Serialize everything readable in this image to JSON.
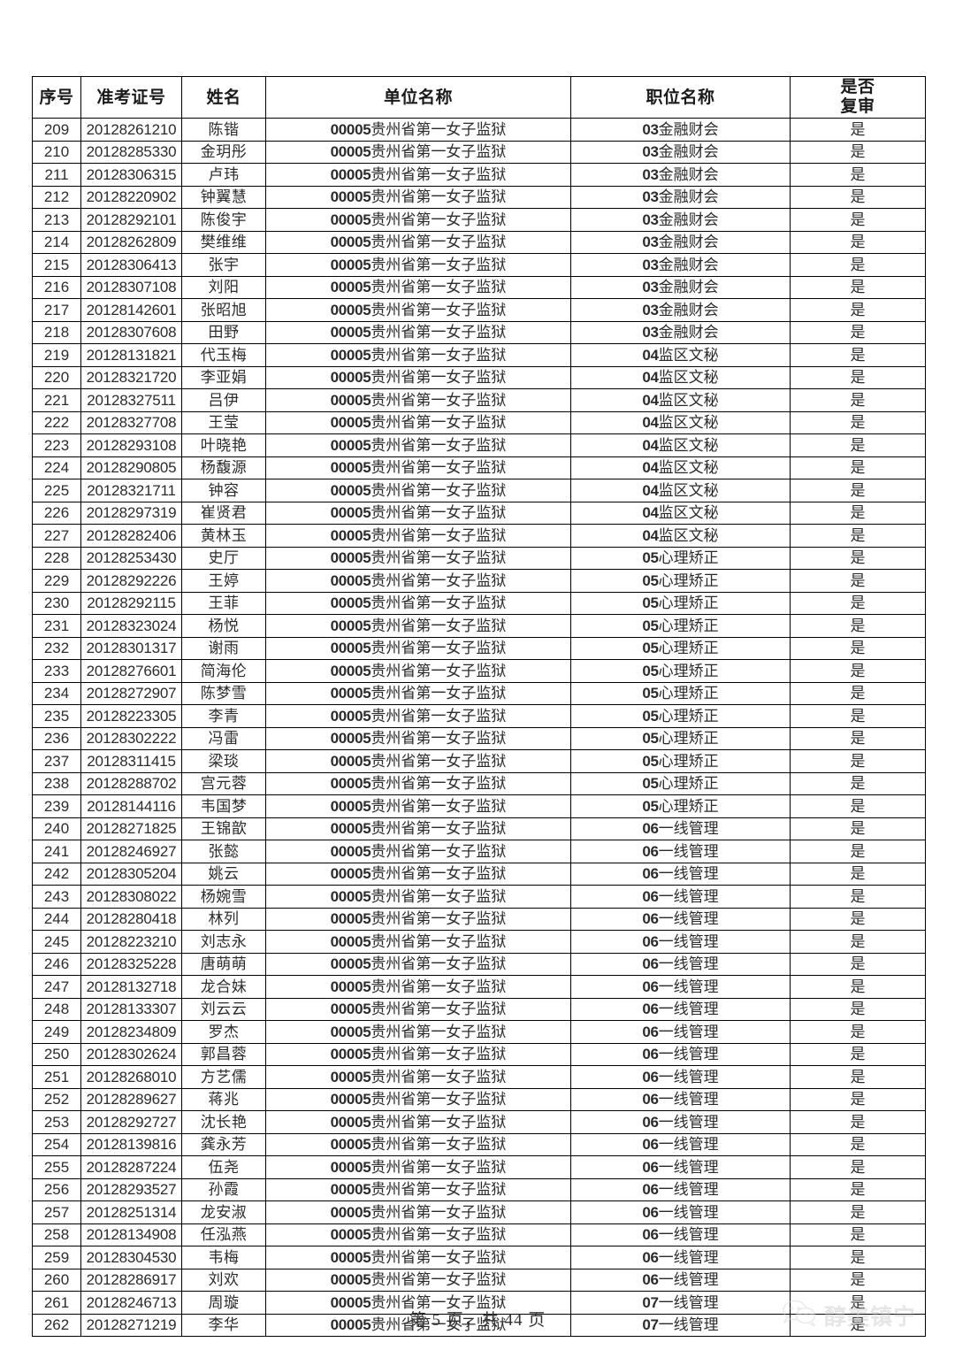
{
  "document": {
    "footer_text": "第 5 页，共 44 页",
    "watermark_text": "醇美镇宁",
    "watermark_icon": "wechat-icon"
  },
  "table": {
    "headers": {
      "seq": "序号",
      "admission_no": "准考证号",
      "name": "姓名",
      "unit_name": "单位名称",
      "post_name": "职位名称",
      "review_line1": "是否",
      "review_line2": "复审"
    },
    "rows": [
      {
        "seq": "209",
        "adm": "20128261210",
        "name": "陈锴",
        "unit_code": "00005",
        "unit": "贵州省第一女子监狱",
        "post_code": "03",
        "post": "金融财会",
        "rev": "是"
      },
      {
        "seq": "210",
        "adm": "20128285330",
        "name": "金玥彤",
        "unit_code": "00005",
        "unit": "贵州省第一女子监狱",
        "post_code": "03",
        "post": "金融财会",
        "rev": "是"
      },
      {
        "seq": "211",
        "adm": "20128306315",
        "name": "卢玮",
        "unit_code": "00005",
        "unit": "贵州省第一女子监狱",
        "post_code": "03",
        "post": "金融财会",
        "rev": "是"
      },
      {
        "seq": "212",
        "adm": "20128220902",
        "name": "钟翼慧",
        "unit_code": "00005",
        "unit": "贵州省第一女子监狱",
        "post_code": "03",
        "post": "金融财会",
        "rev": "是"
      },
      {
        "seq": "213",
        "adm": "20128292101",
        "name": "陈俊宇",
        "unit_code": "00005",
        "unit": "贵州省第一女子监狱",
        "post_code": "03",
        "post": "金融财会",
        "rev": "是"
      },
      {
        "seq": "214",
        "adm": "20128262809",
        "name": "樊维维",
        "unit_code": "00005",
        "unit": "贵州省第一女子监狱",
        "post_code": "03",
        "post": "金融财会",
        "rev": "是"
      },
      {
        "seq": "215",
        "adm": "20128306413",
        "name": "张宇",
        "unit_code": "00005",
        "unit": "贵州省第一女子监狱",
        "post_code": "03",
        "post": "金融财会",
        "rev": "是"
      },
      {
        "seq": "216",
        "adm": "20128307108",
        "name": "刘阳",
        "unit_code": "00005",
        "unit": "贵州省第一女子监狱",
        "post_code": "03",
        "post": "金融财会",
        "rev": "是"
      },
      {
        "seq": "217",
        "adm": "20128142601",
        "name": "张昭旭",
        "unit_code": "00005",
        "unit": "贵州省第一女子监狱",
        "post_code": "03",
        "post": "金融财会",
        "rev": "是"
      },
      {
        "seq": "218",
        "adm": "20128307608",
        "name": "田野",
        "unit_code": "00005",
        "unit": "贵州省第一女子监狱",
        "post_code": "03",
        "post": "金融财会",
        "rev": "是"
      },
      {
        "seq": "219",
        "adm": "20128131821",
        "name": "代玉梅",
        "unit_code": "00005",
        "unit": "贵州省第一女子监狱",
        "post_code": "04",
        "post": "监区文秘",
        "rev": "是"
      },
      {
        "seq": "220",
        "adm": "20128321720",
        "name": "李亚娟",
        "unit_code": "00005",
        "unit": "贵州省第一女子监狱",
        "post_code": "04",
        "post": "监区文秘",
        "rev": "是"
      },
      {
        "seq": "221",
        "adm": "20128327511",
        "name": "吕伊",
        "unit_code": "00005",
        "unit": "贵州省第一女子监狱",
        "post_code": "04",
        "post": "监区文秘",
        "rev": "是"
      },
      {
        "seq": "222",
        "adm": "20128327708",
        "name": "王莹",
        "unit_code": "00005",
        "unit": "贵州省第一女子监狱",
        "post_code": "04",
        "post": "监区文秘",
        "rev": "是"
      },
      {
        "seq": "223",
        "adm": "20128293108",
        "name": "叶晓艳",
        "unit_code": "00005",
        "unit": "贵州省第一女子监狱",
        "post_code": "04",
        "post": "监区文秘",
        "rev": "是"
      },
      {
        "seq": "224",
        "adm": "20128290805",
        "name": "杨馥源",
        "unit_code": "00005",
        "unit": "贵州省第一女子监狱",
        "post_code": "04",
        "post": "监区文秘",
        "rev": "是"
      },
      {
        "seq": "225",
        "adm": "20128321711",
        "name": "钟容",
        "unit_code": "00005",
        "unit": "贵州省第一女子监狱",
        "post_code": "04",
        "post": "监区文秘",
        "rev": "是"
      },
      {
        "seq": "226",
        "adm": "20128297319",
        "name": "崔贤君",
        "unit_code": "00005",
        "unit": "贵州省第一女子监狱",
        "post_code": "04",
        "post": "监区文秘",
        "rev": "是"
      },
      {
        "seq": "227",
        "adm": "20128282406",
        "name": "黄林玉",
        "unit_code": "00005",
        "unit": "贵州省第一女子监狱",
        "post_code": "04",
        "post": "监区文秘",
        "rev": "是"
      },
      {
        "seq": "228",
        "adm": "20128253430",
        "name": "史厅",
        "unit_code": "00005",
        "unit": "贵州省第一女子监狱",
        "post_code": "05",
        "post": "心理矫正",
        "rev": "是"
      },
      {
        "seq": "229",
        "adm": "20128292226",
        "name": "王婷",
        "unit_code": "00005",
        "unit": "贵州省第一女子监狱",
        "post_code": "05",
        "post": "心理矫正",
        "rev": "是"
      },
      {
        "seq": "230",
        "adm": "20128292115",
        "name": "王菲",
        "unit_code": "00005",
        "unit": "贵州省第一女子监狱",
        "post_code": "05",
        "post": "心理矫正",
        "rev": "是"
      },
      {
        "seq": "231",
        "adm": "20128323024",
        "name": "杨悦",
        "unit_code": "00005",
        "unit": "贵州省第一女子监狱",
        "post_code": "05",
        "post": "心理矫正",
        "rev": "是"
      },
      {
        "seq": "232",
        "adm": "20128301317",
        "name": "谢雨",
        "unit_code": "00005",
        "unit": "贵州省第一女子监狱",
        "post_code": "05",
        "post": "心理矫正",
        "rev": "是"
      },
      {
        "seq": "233",
        "adm": "20128276601",
        "name": "简海伦",
        "unit_code": "00005",
        "unit": "贵州省第一女子监狱",
        "post_code": "05",
        "post": "心理矫正",
        "rev": "是"
      },
      {
        "seq": "234",
        "adm": "20128272907",
        "name": "陈梦雪",
        "unit_code": "00005",
        "unit": "贵州省第一女子监狱",
        "post_code": "05",
        "post": "心理矫正",
        "rev": "是"
      },
      {
        "seq": "235",
        "adm": "20128223305",
        "name": "李青",
        "unit_code": "00005",
        "unit": "贵州省第一女子监狱",
        "post_code": "05",
        "post": "心理矫正",
        "rev": "是"
      },
      {
        "seq": "236",
        "adm": "20128302222",
        "name": "冯雷",
        "unit_code": "00005",
        "unit": "贵州省第一女子监狱",
        "post_code": "05",
        "post": "心理矫正",
        "rev": "是"
      },
      {
        "seq": "237",
        "adm": "20128311415",
        "name": "梁琰",
        "unit_code": "00005",
        "unit": "贵州省第一女子监狱",
        "post_code": "05",
        "post": "心理矫正",
        "rev": "是"
      },
      {
        "seq": "238",
        "adm": "20128288702",
        "name": "宫元蓉",
        "unit_code": "00005",
        "unit": "贵州省第一女子监狱",
        "post_code": "05",
        "post": "心理矫正",
        "rev": "是"
      },
      {
        "seq": "239",
        "adm": "20128144116",
        "name": "韦国梦",
        "unit_code": "00005",
        "unit": "贵州省第一女子监狱",
        "post_code": "05",
        "post": "心理矫正",
        "rev": "是"
      },
      {
        "seq": "240",
        "adm": "20128271825",
        "name": "王锦歆",
        "unit_code": "00005",
        "unit": "贵州省第一女子监狱",
        "post_code": "06",
        "post": "一线管理",
        "rev": "是"
      },
      {
        "seq": "241",
        "adm": "20128246927",
        "name": "张懿",
        "unit_code": "00005",
        "unit": "贵州省第一女子监狱",
        "post_code": "06",
        "post": "一线管理",
        "rev": "是"
      },
      {
        "seq": "242",
        "adm": "20128305204",
        "name": "姚云",
        "unit_code": "00005",
        "unit": "贵州省第一女子监狱",
        "post_code": "06",
        "post": "一线管理",
        "rev": "是"
      },
      {
        "seq": "243",
        "adm": "20128308022",
        "name": "杨婉雪",
        "unit_code": "00005",
        "unit": "贵州省第一女子监狱",
        "post_code": "06",
        "post": "一线管理",
        "rev": "是"
      },
      {
        "seq": "244",
        "adm": "20128280418",
        "name": "林列",
        "unit_code": "00005",
        "unit": "贵州省第一女子监狱",
        "post_code": "06",
        "post": "一线管理",
        "rev": "是"
      },
      {
        "seq": "245",
        "adm": "20128223210",
        "name": "刘志永",
        "unit_code": "00005",
        "unit": "贵州省第一女子监狱",
        "post_code": "06",
        "post": "一线管理",
        "rev": "是"
      },
      {
        "seq": "246",
        "adm": "20128325228",
        "name": "唐萌萌",
        "unit_code": "00005",
        "unit": "贵州省第一女子监狱",
        "post_code": "06",
        "post": "一线管理",
        "rev": "是"
      },
      {
        "seq": "247",
        "adm": "20128132718",
        "name": "龙合妹",
        "unit_code": "00005",
        "unit": "贵州省第一女子监狱",
        "post_code": "06",
        "post": "一线管理",
        "rev": "是"
      },
      {
        "seq": "248",
        "adm": "20128133307",
        "name": "刘云云",
        "unit_code": "00005",
        "unit": "贵州省第一女子监狱",
        "post_code": "06",
        "post": "一线管理",
        "rev": "是"
      },
      {
        "seq": "249",
        "adm": "20128234809",
        "name": "罗杰",
        "unit_code": "00005",
        "unit": "贵州省第一女子监狱",
        "post_code": "06",
        "post": "一线管理",
        "rev": "是"
      },
      {
        "seq": "250",
        "adm": "20128302624",
        "name": "郭昌蓉",
        "unit_code": "00005",
        "unit": "贵州省第一女子监狱",
        "post_code": "06",
        "post": "一线管理",
        "rev": "是"
      },
      {
        "seq": "251",
        "adm": "20128268010",
        "name": "方艺儒",
        "unit_code": "00005",
        "unit": "贵州省第一女子监狱",
        "post_code": "06",
        "post": "一线管理",
        "rev": "是"
      },
      {
        "seq": "252",
        "adm": "20128289627",
        "name": "蒋兆",
        "unit_code": "00005",
        "unit": "贵州省第一女子监狱",
        "post_code": "06",
        "post": "一线管理",
        "rev": "是"
      },
      {
        "seq": "253",
        "adm": "20128292727",
        "name": "沈长艳",
        "unit_code": "00005",
        "unit": "贵州省第一女子监狱",
        "post_code": "06",
        "post": "一线管理",
        "rev": "是"
      },
      {
        "seq": "254",
        "adm": "20128139816",
        "name": "龚永芳",
        "unit_code": "00005",
        "unit": "贵州省第一女子监狱",
        "post_code": "06",
        "post": "一线管理",
        "rev": "是"
      },
      {
        "seq": "255",
        "adm": "20128287224",
        "name": "伍尧",
        "unit_code": "00005",
        "unit": "贵州省第一女子监狱",
        "post_code": "06",
        "post": "一线管理",
        "rev": "是"
      },
      {
        "seq": "256",
        "adm": "20128293527",
        "name": "孙霞",
        "unit_code": "00005",
        "unit": "贵州省第一女子监狱",
        "post_code": "06",
        "post": "一线管理",
        "rev": "是"
      },
      {
        "seq": "257",
        "adm": "20128251314",
        "name": "龙安淑",
        "unit_code": "00005",
        "unit": "贵州省第一女子监狱",
        "post_code": "06",
        "post": "一线管理",
        "rev": "是"
      },
      {
        "seq": "258",
        "adm": "20128134908",
        "name": "任泓燕",
        "unit_code": "00005",
        "unit": "贵州省第一女子监狱",
        "post_code": "06",
        "post": "一线管理",
        "rev": "是"
      },
      {
        "seq": "259",
        "adm": "20128304530",
        "name": "韦梅",
        "unit_code": "00005",
        "unit": "贵州省第一女子监狱",
        "post_code": "06",
        "post": "一线管理",
        "rev": "是"
      },
      {
        "seq": "260",
        "adm": "20128286917",
        "name": "刘欢",
        "unit_code": "00005",
        "unit": "贵州省第一女子监狱",
        "post_code": "06",
        "post": "一线管理",
        "rev": "是"
      },
      {
        "seq": "261",
        "adm": "20128246713",
        "name": "周璇",
        "unit_code": "00005",
        "unit": "贵州省第一女子监狱",
        "post_code": "07",
        "post": "一线管理",
        "rev": "是"
      },
      {
        "seq": "262",
        "adm": "20128271219",
        "name": "李华",
        "unit_code": "00005",
        "unit": "贵州省第一女子监狱",
        "post_code": "07",
        "post": "一线管理",
        "rev": "是"
      }
    ]
  }
}
